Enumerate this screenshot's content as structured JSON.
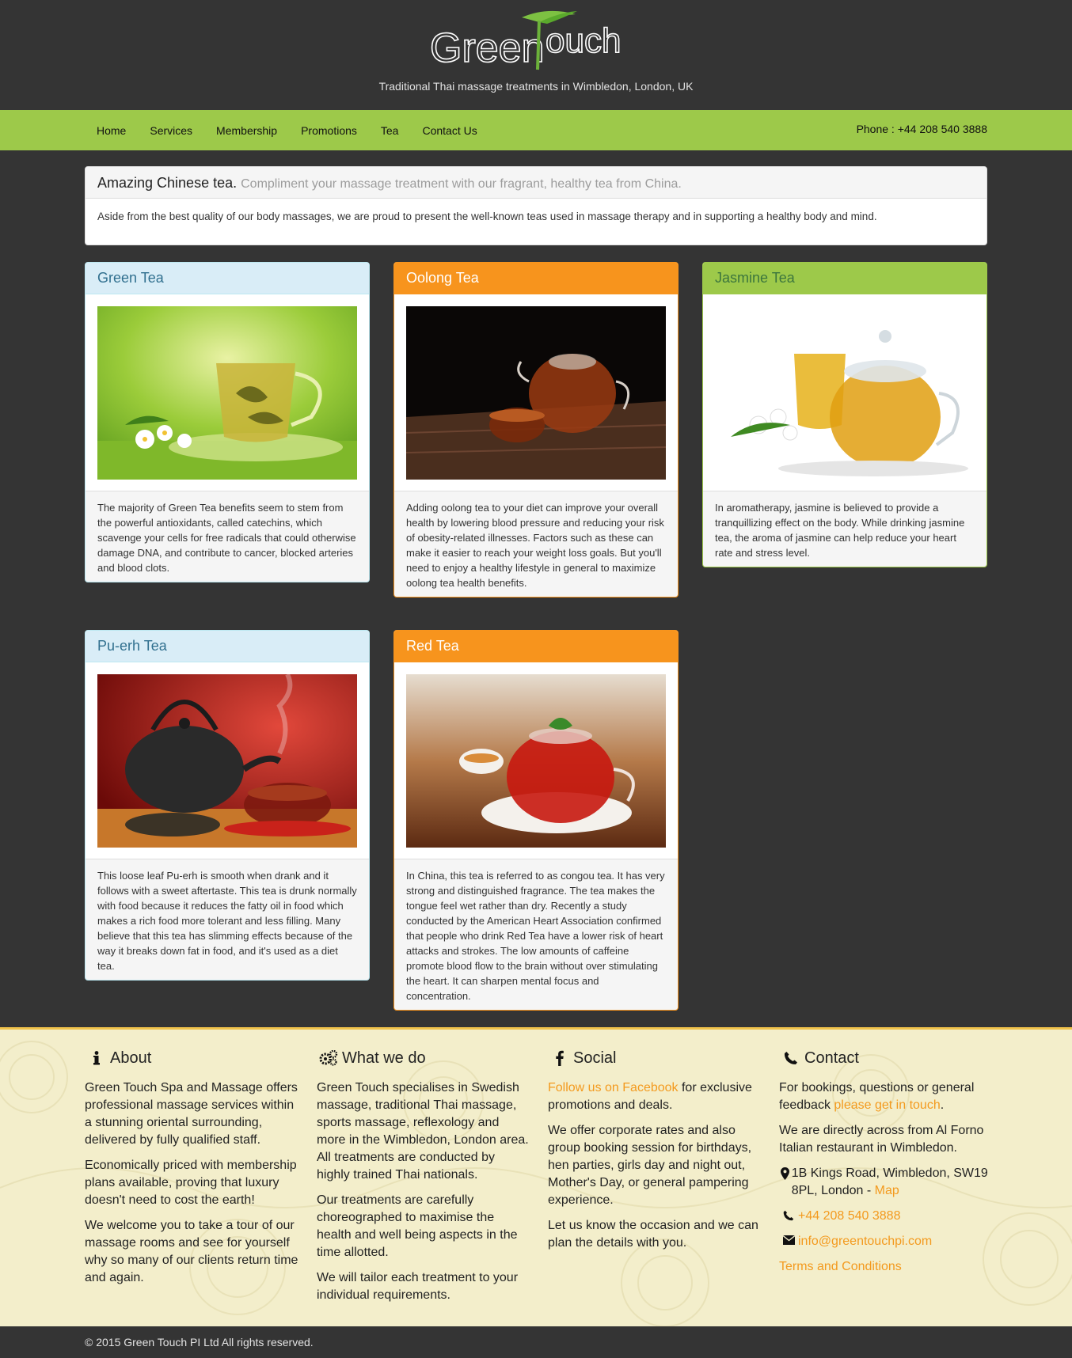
{
  "brand": {
    "logo_text_left": "Green",
    "logo_text_right": "ouch",
    "tagline": "Traditional Thai massage treatments in Wimbledon, London, UK"
  },
  "nav": {
    "items": [
      "Home",
      "Services",
      "Membership",
      "Promotions",
      "Tea",
      "Contact Us"
    ],
    "phone": "Phone : +44 208 540 3888"
  },
  "intro": {
    "title": "Amazing Chinese tea.",
    "subtitle": "Compliment your massage treatment with our fragrant, healthy tea from China.",
    "body": "Aside from the best quality of our body massages, we are proud to present the well-known teas used in massage therapy and in supporting a healthy body and mind."
  },
  "teas": [
    {
      "name": "Green Tea",
      "style": "info",
      "image": "green-tea-cup-with-jasmine",
      "text": "The majority of Green Tea benefits seem to stem from the powerful antioxidants, called catechins, which scavenge your cells for free radicals that could otherwise damage DNA, and contribute to cancer, blocked arteries and blood clots."
    },
    {
      "name": "Oolong Tea",
      "style": "warning",
      "image": "glass-teapot-with-cup",
      "text": "Adding oolong tea to your diet can improve your overall health by lowering blood pressure and reducing your risk of obesity-related illnesses. Factors such as these can make it easier to reach your weight loss goals. But you'll need to enjoy a healthy lifestyle in general to maximize oolong tea health benefits."
    },
    {
      "name": "Jasmine Tea",
      "style": "success",
      "image": "jasmine-teapot-and-cup",
      "text": "In aromatherapy, jasmine is believed to provide a tranquillizing effect on the body. While drinking jasmine tea, the aroma of jasmine can help reduce your heart rate and stress level."
    },
    {
      "name": "Pu-erh Tea",
      "style": "info",
      "image": "cast-iron-teapot-with-cup",
      "text": "This loose leaf Pu-erh is smooth when drank and it follows with a sweet aftertaste. This tea is drunk normally with food because it reduces the fatty oil in food which makes a rich food more tolerant and less filling. Many believe that this tea has slimming effects because of the way it breaks down fat in food, and it's used as a diet tea."
    },
    {
      "name": "Red Tea",
      "style": "warning",
      "image": "red-tea-glass-pot-with-mint",
      "text": "In China, this tea is referred to as congou tea. It has very strong and distinguished fragrance. The tea makes the tongue feel wet rather than dry. Recently a study conducted by the American Heart Association confirmed that people who drink Red Tea have a lower risk of heart attacks and strokes. The low amounts of caffeine promote blood flow to the brain without over stimulating the heart. It can sharpen mental focus and concentration."
    }
  ],
  "footer": {
    "about": {
      "title": "About",
      "icon": "info-icon",
      "p1": "Green Touch Spa and Massage offers professional massage services within a stunning oriental surrounding, delivered by fully qualified staff.",
      "p2": "Economically priced with membership plans available, proving that luxury doesn't need to cost the earth!",
      "p3": "We welcome you to take a tour of our massage rooms and see for yourself why so many of our clients return time and again."
    },
    "whatwedo": {
      "title": "What we do",
      "icon": "gears-icon",
      "p1": "Green Touch specialises in Swedish massage, traditional Thai massage, sports massage, reflexology and more in the Wimbledon, London area. All treatments are conducted by highly trained Thai nationals.",
      "p2": "Our treatments are carefully choreographed to maximise the health and well being aspects in the time allotted.",
      "p3": "We will tailor each treatment to your individual requirements."
    },
    "social": {
      "title": "Social",
      "icon": "facebook-icon",
      "fb_link": "Follow us on Facebook",
      "fb_rest": " for exclusive promotions and deals.",
      "p2": "We offer corporate rates and also group booking session for birthdays, hen parties, girls day and night out, Mother's Day, or general pampering experience.",
      "p3": "Let us know the occasion and we can plan the details with you."
    },
    "contact": {
      "title": "Contact",
      "icon": "phone-icon",
      "p1_text": "For bookings, questions or general feedback ",
      "p1_link": "please get in touch",
      "p1_end": ".",
      "p2": "We are directly across from Al Forno Italian restaurant in Wimbledon.",
      "address": "1B Kings Road, Wimbledon, SW19 8PL, London - ",
      "map_link": "Map",
      "phone": "+44 208 540 3888",
      "email": "info@greentouchpi.com",
      "terms": "Terms and Conditions"
    }
  },
  "copyright": "© 2015 Green Touch PI Ltd All rights reserved.",
  "colors": {
    "dark": "#343434",
    "green": "#9dc94a",
    "orange": "#f7941d",
    "info_bg": "#d9edf7",
    "link": "#f39a1e"
  }
}
